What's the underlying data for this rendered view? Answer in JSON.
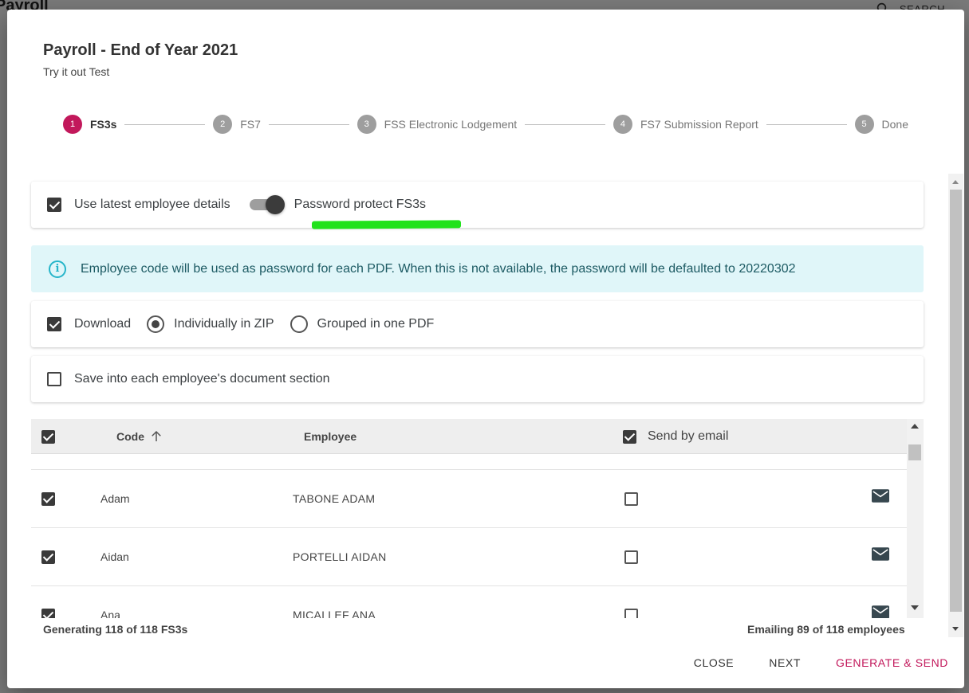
{
  "background": {
    "app_title": "Payroll",
    "search_label": "SEARCH"
  },
  "dialog": {
    "title": "Payroll - End of Year 2021",
    "subtitle": "Try it out Test"
  },
  "stepper": {
    "steps": [
      {
        "number": "1",
        "label": "FS3s",
        "active": true
      },
      {
        "number": "2",
        "label": "FS7",
        "active": false
      },
      {
        "number": "3",
        "label": "FSS Electronic Lodgement",
        "active": false
      },
      {
        "number": "4",
        "label": "FS7 Submission Report",
        "active": false
      },
      {
        "number": "5",
        "label": "Done",
        "active": false
      }
    ]
  },
  "options": {
    "use_latest_label": "Use latest employee details",
    "use_latest_checked": true,
    "password_protect_label": "Password protect FS3s",
    "password_protect_on": true,
    "info_text": "Employee code will be used as password for each PDF. When this is not available, the password will be defaulted to 20220302",
    "download_label": "Download",
    "download_checked": true,
    "individually_zip_label": "Individually in ZIP",
    "grouped_pdf_label": "Grouped in one PDF",
    "selected_download_mode": "Individually in ZIP",
    "save_doc_label": "Save into each employee's document section",
    "save_doc_checked": false
  },
  "table": {
    "headers": {
      "code": "Code",
      "employee": "Employee",
      "send_by_email": "Send by email"
    },
    "rows": [
      {
        "selected": true,
        "code": "Adam",
        "employee": "TABONE ADAM",
        "email": false
      },
      {
        "selected": true,
        "code": "Aidan",
        "employee": "PORTELLI AIDAN",
        "email": false
      },
      {
        "selected": true,
        "code": "Ana",
        "employee": "MICALLEF ANA",
        "email": false
      }
    ]
  },
  "footer": {
    "generating": "Generating 118 of 118 FS3s",
    "emailing": "Emailing 89 of 118 employees",
    "close": "CLOSE",
    "next": "NEXT",
    "generate_send": "GENERATE & SEND"
  },
  "colors": {
    "accent": "#c2185b",
    "info_bg": "#e0f6f9",
    "info_icon": "#26b5c9",
    "highlight": "#21e21b"
  }
}
